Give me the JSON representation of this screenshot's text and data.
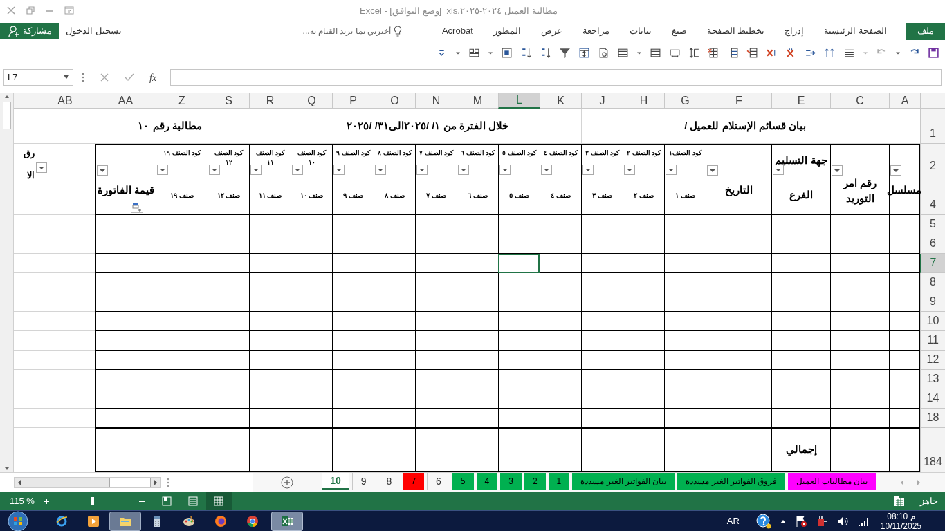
{
  "window": {
    "title": "مطالبة العميل ٢٠٢٤-٢٠٢٥.xls  [وضع التوافق] - Excel"
  },
  "ribbon_tabs": [
    {
      "label": "ملف",
      "selected": true
    },
    {
      "label": "الصفحة الرئيسية",
      "selected": false
    },
    {
      "label": "إدراج",
      "selected": false
    },
    {
      "label": "تخطيط الصفحة",
      "selected": false
    },
    {
      "label": "صيغ",
      "selected": false
    },
    {
      "label": "بيانات",
      "selected": false
    },
    {
      "label": "مراجعة",
      "selected": false
    },
    {
      "label": "عرض",
      "selected": false
    },
    {
      "label": "المطور",
      "selected": false
    },
    {
      "label": "Acrobat",
      "selected": false
    }
  ],
  "tell_me": {
    "placeholder": "أخبرني بما تريد القيام به..."
  },
  "sign_in": "تسجيل الدخول",
  "share": "مشاركة",
  "formula_bar": {
    "name_box": "L7",
    "function_button": "fx"
  },
  "columns": [
    {
      "label": "A",
      "selected": false
    },
    {
      "label": "C",
      "selected": false
    },
    {
      "label": "E",
      "selected": false
    },
    {
      "label": "F",
      "selected": false
    },
    {
      "label": "G",
      "selected": false
    },
    {
      "label": "H",
      "selected": false
    },
    {
      "label": "J",
      "selected": false
    },
    {
      "label": "K",
      "selected": false
    },
    {
      "label": "L",
      "selected": true
    },
    {
      "label": "M",
      "selected": false
    },
    {
      "label": "N",
      "selected": false
    },
    {
      "label": "O",
      "selected": false
    },
    {
      "label": "P",
      "selected": false
    },
    {
      "label": "Q",
      "selected": false
    },
    {
      "label": "R",
      "selected": false
    },
    {
      "label": "S",
      "selected": false
    },
    {
      "label": "Z",
      "selected": false
    },
    {
      "label": "AA",
      "selected": false
    },
    {
      "label": "AB",
      "selected": false
    }
  ],
  "rows": [
    {
      "label": "1",
      "selected": false
    },
    {
      "label": "2",
      "selected": false
    },
    {
      "label": "4",
      "selected": false
    },
    {
      "label": "5",
      "selected": false
    },
    {
      "label": "6",
      "selected": false
    },
    {
      "label": "7",
      "selected": true
    },
    {
      "label": "8",
      "selected": false
    },
    {
      "label": "9",
      "selected": false
    },
    {
      "label": "10",
      "selected": false
    },
    {
      "label": "11",
      "selected": false
    },
    {
      "label": "12",
      "selected": false
    },
    {
      "label": "13",
      "selected": false
    },
    {
      "label": "14",
      "selected": false
    },
    {
      "label": "18",
      "selected": false
    },
    {
      "label": "184",
      "selected": false
    }
  ],
  "title_row": [
    {
      "text": "بيان قسائم الإستلام للعميل /"
    },
    {
      "text": "خلال الفترة من ١/ /٢٠٢٥الى٣١/ /٢٠٢٥"
    },
    {
      "text": "مطالبة رقم"
    },
    {
      "text": "١٠"
    }
  ],
  "headers": [
    {
      "kind": "merged",
      "text": "مسلسل"
    },
    {
      "kind": "merged",
      "text": "رقم امر\nالتوريد"
    },
    {
      "kind": "split",
      "top": "جهة التسليم",
      "bottom": "الفرع"
    },
    {
      "kind": "merged",
      "text": "التاريخ"
    },
    {
      "kind": "code",
      "top": "كود الصنف١",
      "bottom": "صنف ١"
    },
    {
      "kind": "code",
      "top": "كود الصنف ٢",
      "bottom": "صنف ٢"
    },
    {
      "kind": "code",
      "top": "كود الصنف ٣",
      "bottom": "صنف ٣"
    },
    {
      "kind": "code",
      "top": "كود الصنف ٤",
      "bottom": "صنف ٤"
    },
    {
      "kind": "code",
      "top": "كود الصنف ٥",
      "bottom": "صنف ٥"
    },
    {
      "kind": "code",
      "top": "كود الصنف ٦",
      "bottom": "صنف ٦"
    },
    {
      "kind": "code",
      "top": "كود الصنف ٧",
      "bottom": "صنف ٧"
    },
    {
      "kind": "code",
      "top": "كود الصنف ٨",
      "bottom": "صنف ٨"
    },
    {
      "kind": "code",
      "top": "كود الصنف ٩",
      "bottom": "صنف ٩"
    },
    {
      "kind": "code",
      "top": "كود الصنف\n١٠",
      "bottom": "صنف ١٠"
    },
    {
      "kind": "code",
      "top": "كود الصنف\n١١",
      "bottom": "صنف ١١"
    },
    {
      "kind": "code",
      "top": "كود الصنف\n١٢",
      "bottom": "صنف ١٢"
    },
    {
      "kind": "code",
      "top": "كود الصنف ١٩",
      "bottom": "صنف ١٩"
    },
    {
      "kind": "merged",
      "text": "قيمة الفاتورة"
    },
    {
      "kind": "blank"
    }
  ],
  "cut_column": {
    "top": "رق",
    "bottom": "الا"
  },
  "total_label": "إجمالي",
  "sheet_tabs": [
    {
      "label": "بيان مطالبات العميل",
      "selected": false,
      "color": "#ff00ff"
    },
    {
      "label": "فروق الفواتير الغير مسددة",
      "selected": false,
      "color": "#00b050"
    },
    {
      "label": "بيان الفواتير الغير مسددة",
      "selected": false,
      "color": "#00b050"
    },
    {
      "label": "1",
      "selected": false,
      "color": "#00b050"
    },
    {
      "label": "2",
      "selected": false,
      "color": "#00b050"
    },
    {
      "label": "3",
      "selected": false,
      "color": "#00b050"
    },
    {
      "label": "4",
      "selected": false,
      "color": "#00b050"
    },
    {
      "label": "5",
      "selected": false,
      "color": "#00b050"
    },
    {
      "label": "6",
      "selected": false
    },
    {
      "label": "7",
      "selected": false,
      "color": "#ff0000"
    },
    {
      "label": "8",
      "selected": false
    },
    {
      "label": "9",
      "selected": false
    },
    {
      "label": "10",
      "selected": true
    }
  ],
  "status_bar": {
    "text": "جاهز",
    "zoom": "115 %",
    "zoom_slider": {
      "level": 0.5
    }
  },
  "taskbar": {
    "language": "AR",
    "time": "08:10 م",
    "date": "10/11/2025"
  }
}
